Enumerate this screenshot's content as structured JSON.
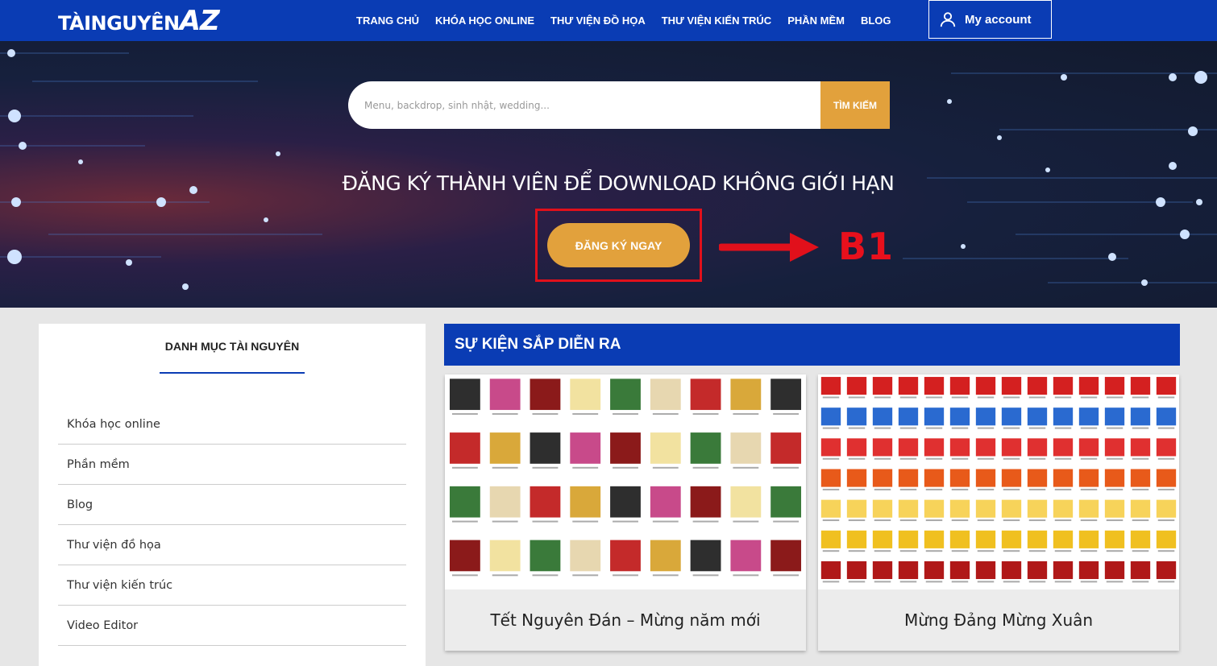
{
  "header": {
    "logo_main": "TÀINGUYÊN",
    "logo_az": "AZ",
    "nav": [
      "TRANG CHỦ",
      "KHÓA HỌC ONLINE",
      "THƯ VIỆN ĐỒ HỌA",
      "THƯ VIỆN KIẾN TRÚC",
      "PHẦN MỀM",
      "BLOG"
    ],
    "account_label": "My account",
    "account_icon": "user-icon"
  },
  "hero": {
    "search_placeholder": "Menu, backdrop, sinh nhật, wedding...",
    "search_button": "TÌM KIẾM",
    "title": "ĐĂNG KÝ THÀNH VIÊN ĐỂ DOWNLOAD KHÔNG GIỚI HẠN",
    "signup_button": "ĐĂNG KÝ NGAY",
    "step_label": "B1",
    "annotation_color": "#e1101b"
  },
  "sidebar": {
    "title": "DANH MỤC TÀI NGUYÊN",
    "items": [
      "Khóa học online",
      "Phần mềm",
      "Blog",
      "Thư viện đồ họa",
      "Thư viện kiến trúc",
      "Video Editor"
    ]
  },
  "events": {
    "header": "SỰ KIỆN SẮP DIỄN RA",
    "cards": [
      {
        "title": "Tết Nguyên Đán – Mừng năm mới"
      },
      {
        "title": "Mừng Đảng Mừng Xuân"
      }
    ]
  },
  "colors": {
    "brand_blue": "#0a3cb4",
    "accent_gold": "#e2a13c"
  }
}
